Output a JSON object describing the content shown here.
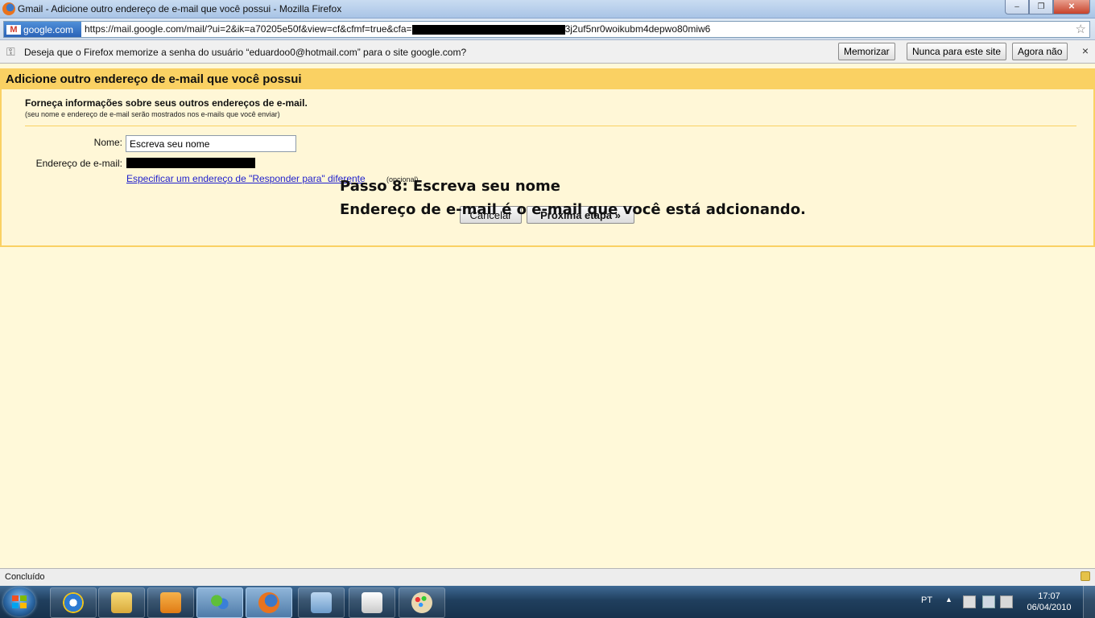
{
  "window": {
    "title": "Gmail - Adicione outro endereço de e-mail que você possui - Mozilla Firefox",
    "buttons": {
      "minimize": "–",
      "maximize": "❐",
      "close": "✕"
    }
  },
  "navbar": {
    "site_badge": "google.com",
    "url_prefix": "https://mail.google.com/mail/?ui=2&ik=a70205e50f&view=cf&cfmf=true&cfa=",
    "url_suffix": "3j2uf5nr0woikubm4depwo80miw6"
  },
  "password_bar": {
    "message": "Deseja que o Firefox memorize a senha do usuário “eduardoo0@hotmail.com” para o site google.com?",
    "remember": "Memorizar",
    "never": "Nunca para este site",
    "not_now": "Agora não",
    "close": "×"
  },
  "panel": {
    "header": "Adicione outro endereço de e-mail que você possui",
    "intro": "Forneça informações sobre seus outros endereços de e-mail.",
    "intro_sub": "(seu nome e endereço de e-mail serão mostrados nos e-mails que você enviar)",
    "name_label": "Nome:",
    "name_value": "Escreva seu nome",
    "email_label": "Endereço de e-mail:",
    "reply_link": "Especificar um endereço de \"Responder para\" diferente",
    "reply_optional": "(opcional)",
    "cancel": "Cancelar",
    "next": "Próxima etapa »"
  },
  "overlay": {
    "line1": "Passo 8: Escreva seu nome",
    "line2": "Endereço de e-mail é o e-mail que você está adcionando."
  },
  "status": {
    "text": "Concluído"
  },
  "taskbar": {
    "language": "PT",
    "time": "17:07",
    "date": "06/04/2010"
  }
}
